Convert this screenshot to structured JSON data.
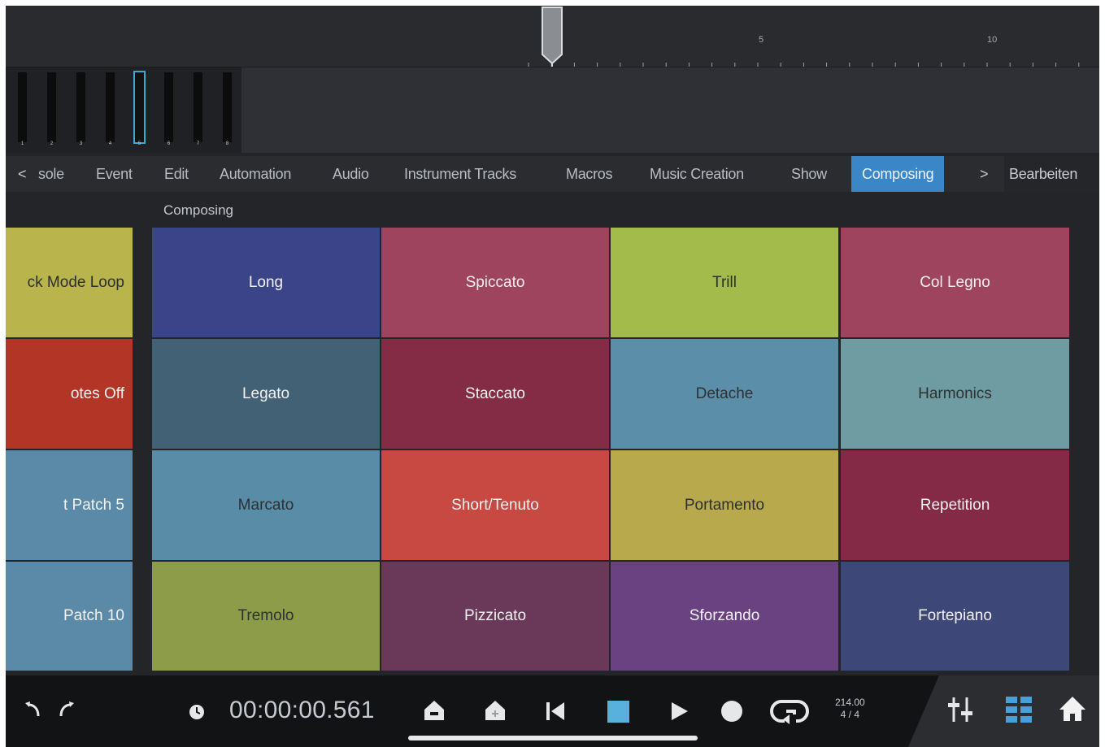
{
  "ruler": {
    "marks": [
      "5",
      "10"
    ]
  },
  "tracks": {
    "numbers": [
      "1",
      "2",
      "3",
      "4",
      "5",
      "6",
      "7",
      "8"
    ],
    "selected_index": 4
  },
  "tabs": {
    "prev_label": "<",
    "items": [
      "sole",
      "Event",
      "Edit",
      "Automation",
      "Audio",
      "Instrument Tracks",
      "Macros",
      "Music Creation",
      "Show",
      "Composing"
    ],
    "active": "Composing",
    "next_label": ">",
    "right_tab": "Bearbeiten"
  },
  "section_title": "Composing",
  "left_pads": [
    {
      "label": "ck Mode Loop",
      "color": "#b9b44b"
    },
    {
      "label": "otes Off",
      "color": "#b23526"
    },
    {
      "label": "t Patch 5",
      "color": "#5a8aa7"
    },
    {
      "label": "Patch 10",
      "color": "#5a8aa7"
    }
  ],
  "pads": [
    [
      {
        "label": "Long",
        "color": "#3b4488"
      },
      {
        "label": "Spiccato",
        "color": "#9e445e"
      },
      {
        "label": "Trill",
        "color": "#a2bb4a"
      },
      {
        "label": "Col Legno",
        "color": "#9e445e"
      }
    ],
    [
      {
        "label": "Legato",
        "color": "#436175"
      },
      {
        "label": "Staccato",
        "color": "#842b45"
      },
      {
        "label": "Detache",
        "color": "#5a8ea9"
      },
      {
        "label": "Harmonics",
        "color": "#6f9ba2"
      }
    ],
    [
      {
        "label": "Marcato",
        "color": "#598ca6"
      },
      {
        "label": "Short/Tenuto",
        "color": "#c84941"
      },
      {
        "label": "Portamento",
        "color": "#b8a94c"
      },
      {
        "label": "Repetition",
        "color": "#852a46"
      }
    ],
    [
      {
        "label": "Tremolo",
        "color": "#8c9c49"
      },
      {
        "label": "Pizzicato",
        "color": "#6a3859"
      },
      {
        "label": "Sforzando",
        "color": "#6a4181"
      },
      {
        "label": "Fortepiano",
        "color": "#3d4778"
      }
    ]
  ],
  "transport": {
    "time": "00:00:00.561",
    "tempo": "214.00",
    "signature": "4 / 4",
    "icons": [
      "undo-icon",
      "redo-icon",
      "clock-icon",
      "eject-icon",
      "home-marker-icon",
      "skip-back-icon",
      "stop-icon",
      "play-icon",
      "record-icon",
      "loop-icon",
      "mixer-icon",
      "grid-icon",
      "home-icon"
    ]
  }
}
